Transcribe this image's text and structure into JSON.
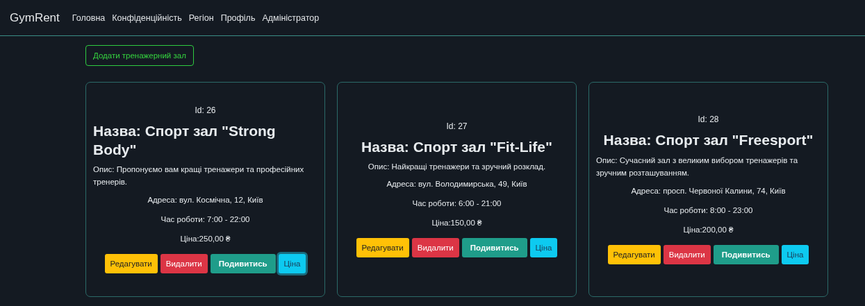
{
  "navbar": {
    "brand": "GymRent",
    "links": [
      "Головна",
      "Конфіденційність",
      "Регіон",
      "Профіль",
      "Адміністратор"
    ]
  },
  "add_button": "Додати тренажерний зал",
  "gyms": [
    {
      "id": "Id: 26",
      "name": "Назва: Спорт зал \"Strong Body\"",
      "description": "Опис: Пропонуємо вам кращі тренажери та професійних тренерів.",
      "address": "Адреса: вул. Космічна, 12, Київ",
      "hours": "Час роботи: 7:00 - 22:00",
      "price": "Ціна:250,00 ₴",
      "buttons": [
        {
          "label": "Редагувати",
          "kind": "edit",
          "focused": false
        },
        {
          "label": "Видалити",
          "kind": "delete",
          "focused": false
        },
        {
          "label": "Подивитись",
          "kind": "view",
          "focused": false
        },
        {
          "label": "Ціна",
          "kind": "price",
          "focused": true
        }
      ]
    },
    {
      "id": "Id: 27",
      "name": "Назва: Спорт зал \"Fit-Life\"",
      "description": "Опис: Найкращі тренажери та зручний розклад.",
      "address": "Адреса: вул. Володимирська, 49, Київ",
      "hours": "Час роботи: 6:00 - 21:00",
      "price": "Ціна:150,00 ₴",
      "buttons": [
        {
          "label": "Редагувати",
          "kind": "edit",
          "focused": false
        },
        {
          "label": "Видалити",
          "kind": "delete",
          "focused": false
        },
        {
          "label": "Подивитись",
          "kind": "view",
          "focused": false
        },
        {
          "label": "Ціна",
          "kind": "price",
          "focused": false
        }
      ]
    },
    {
      "id": "Id: 28",
      "name": "Назва: Спорт зал \"Freesport\"",
      "description": "Опис: Сучасний зал з великим вибором тренажерів та зручним розташуванням.",
      "address": "Адреса: просп. Червоної Калини, 74, Київ",
      "hours": "Час роботи: 8:00 - 23:00",
      "price": "Ціна:200,00 ₴",
      "buttons": [
        {
          "label": "Редагувати",
          "kind": "edit",
          "focused": false
        },
        {
          "label": "Видалити",
          "kind": "delete",
          "focused": false
        },
        {
          "label": "Подивитись",
          "kind": "view",
          "focused": false
        },
        {
          "label": "Ціна",
          "kind": "price",
          "focused": false
        }
      ]
    }
  ]
}
